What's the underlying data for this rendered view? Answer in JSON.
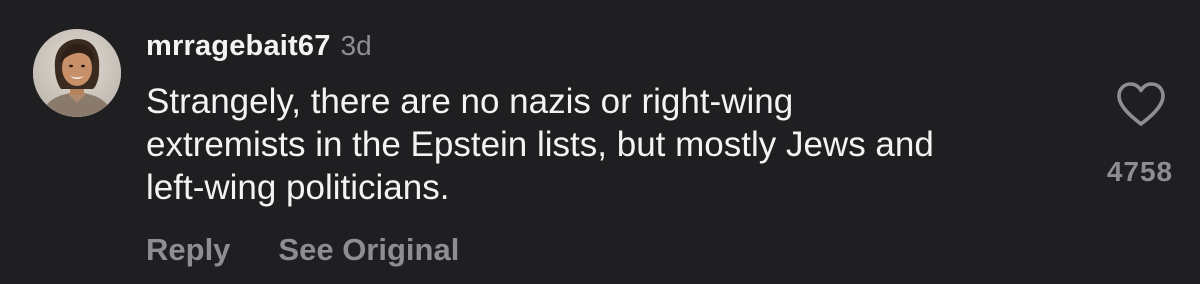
{
  "comment": {
    "username": "mrragebait67",
    "timestamp": "3d",
    "text_lines": [
      "Strangely, there are no nazis or right-wing",
      "extremists in the Epstein lists, but mostly Jews and",
      "left-wing politicians."
    ],
    "actions": {
      "reply_label": "Reply",
      "see_original_label": "See Original"
    },
    "likes": {
      "icon": "heart-icon",
      "count": "4758"
    },
    "avatar": {
      "icon": "avatar"
    }
  },
  "colors": {
    "background": "#1f1f21",
    "primary_text": "#f3f3f3",
    "secondary_text": "#8d8d92"
  }
}
